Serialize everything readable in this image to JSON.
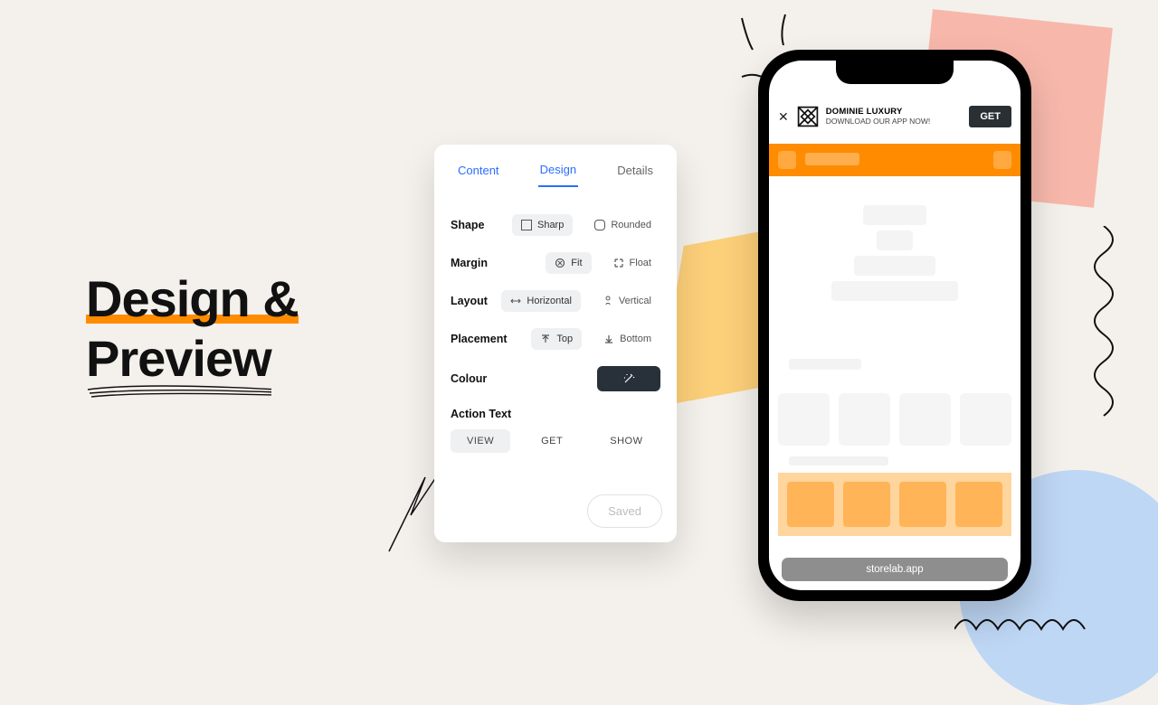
{
  "headline": {
    "line1": "Design &",
    "line2": "Preview"
  },
  "panel": {
    "tabs": {
      "content": "Content",
      "design": "Design",
      "details": "Details"
    },
    "rows": {
      "shape": {
        "label": "Shape",
        "opt1": "Sharp",
        "opt2": "Rounded"
      },
      "margin": {
        "label": "Margin",
        "opt1": "Fit",
        "opt2": "Float"
      },
      "layout": {
        "label": "Layout",
        "opt1": "Horizontal",
        "opt2": "Vertical"
      },
      "placement": {
        "label": "Placement",
        "opt1": "Top",
        "opt2": "Bottom"
      },
      "colour": {
        "label": "Colour"
      }
    },
    "action": {
      "label": "Action Text",
      "view": "VIEW",
      "get": "GET",
      "show": "SHOW"
    },
    "saved": "Saved"
  },
  "phone": {
    "banner": {
      "title": "DOMINIE LUXURY",
      "subtitle": "DOWNLOAD OUR APP NOW!",
      "cta": "GET"
    },
    "url": "storelab.app"
  }
}
